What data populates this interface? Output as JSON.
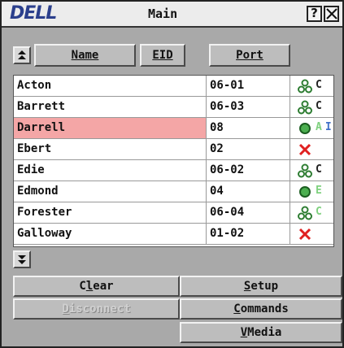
{
  "window": {
    "logo": "DELL",
    "title": "Main",
    "help_label": "?",
    "close_label": "X"
  },
  "header": {
    "name_label": "Name",
    "eid_label": "EID",
    "port_label": "Port"
  },
  "rows": [
    {
      "name": "Acton",
      "port": "06-01",
      "status_icon": "network-icon",
      "letters": [
        "C"
      ],
      "letter_colors": [
        "#222222"
      ],
      "selected": false
    },
    {
      "name": "Barrett",
      "port": "06-03",
      "status_icon": "network-icon",
      "letters": [
        "C"
      ],
      "letter_colors": [
        "#222222"
      ],
      "selected": false
    },
    {
      "name": "Darrell",
      "port": "08",
      "status_icon": "online-circle-icon",
      "letters": [
        "A",
        "I"
      ],
      "letter_colors": [
        "#7fd17f",
        "#4070c8"
      ],
      "selected": true
    },
    {
      "name": "Ebert",
      "port": "02",
      "status_icon": "offline-x-icon",
      "letters": [],
      "letter_colors": [],
      "selected": false
    },
    {
      "name": "Edie",
      "port": "06-02",
      "status_icon": "network-icon",
      "letters": [
        "C"
      ],
      "letter_colors": [
        "#222222"
      ],
      "selected": false
    },
    {
      "name": "Edmond",
      "port": "04",
      "status_icon": "online-circle-icon",
      "letters": [
        "E"
      ],
      "letter_colors": [
        "#7fd17f"
      ],
      "selected": false
    },
    {
      "name": "Forester",
      "port": "06-04",
      "status_icon": "network-icon",
      "letters": [
        "C"
      ],
      "letter_colors": [
        "#7fd17f"
      ],
      "selected": false
    },
    {
      "name": "Galloway",
      "port": "01-02",
      "status_icon": "offline-x-icon",
      "letters": [],
      "letter_colors": [],
      "selected": false
    }
  ],
  "buttons": {
    "clear": "Clear",
    "setup": "Setup",
    "disconnect": "Disconnect",
    "commands": "Commands",
    "vmedia": "VMedia"
  },
  "colors": {
    "selected_row": "#f4a6a6",
    "online_green": "#4caf50",
    "offline_red": "#e02020",
    "logo_blue": "#2b3f8c"
  }
}
